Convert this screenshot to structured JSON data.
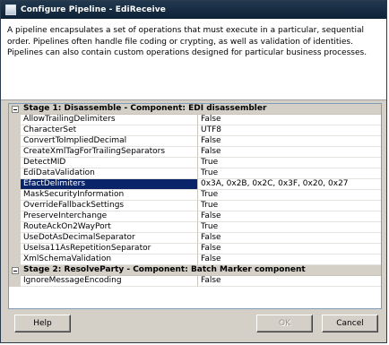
{
  "window": {
    "title": "Configure Pipeline - EdiReceive",
    "description": "A pipeline encapsulates a set of operations that must execute in a particular, sequential order. Pipelines often handle file coding or crypting, as well as validation of identities. Pipelines can also contain custom operations designed for particular business processes."
  },
  "grid": {
    "stage1": {
      "label": "Stage 1: Disassemble - Component: EDI disassembler",
      "properties": [
        {
          "name": "AllowTrailingDelimiters",
          "value": "False"
        },
        {
          "name": "CharacterSet",
          "value": "UTF8"
        },
        {
          "name": "ConvertToImpliedDecimal",
          "value": "False"
        },
        {
          "name": "CreateXmlTagForTrailingSeparators",
          "value": "False"
        },
        {
          "name": "DetectMID",
          "value": "True"
        },
        {
          "name": "EdiDataValidation",
          "value": "True"
        },
        {
          "name": "EfactDelimiters",
          "value": "0x3A, 0x2B, 0x2C, 0x3F, 0x20, 0x27"
        },
        {
          "name": "MaskSecurityInformation",
          "value": "True"
        },
        {
          "name": "OverrideFallbackSettings",
          "value": "True"
        },
        {
          "name": "PreserveInterchange",
          "value": "False"
        },
        {
          "name": "RouteAckOn2WayPort",
          "value": "True"
        },
        {
          "name": "UseDotAsDecimalSeparator",
          "value": "False"
        },
        {
          "name": "UseIsa11AsRepetitionSeparator",
          "value": "False"
        },
        {
          "name": "XmlSchemaValidation",
          "value": "False"
        }
      ]
    },
    "stage2": {
      "label": "Stage 2: ResolveParty - Component: Batch Marker component",
      "properties": [
        {
          "name": "IgnoreMessageEncoding",
          "value": "False"
        }
      ]
    }
  },
  "buttons": {
    "help": "Help",
    "ok": "OK",
    "cancel": "Cancel"
  }
}
